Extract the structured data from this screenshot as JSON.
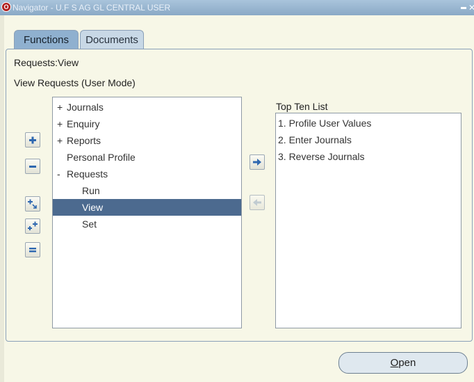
{
  "window": {
    "title": "Navigator - U.F S AG GL CENTRAL USER"
  },
  "tabs": [
    {
      "label": "Functions",
      "active": true
    },
    {
      "label": "Documents",
      "active": false
    }
  ],
  "header": {
    "heading": "Requests:View",
    "subheading": "View Requests (User Mode)"
  },
  "tree": {
    "items": [
      {
        "prefix": "+",
        "label": "Journals"
      },
      {
        "prefix": "+",
        "label": "Enquiry"
      },
      {
        "prefix": "+",
        "label": "Reports"
      },
      {
        "prefix": "",
        "label": "Personal Profile"
      },
      {
        "prefix": "-",
        "label": "Requests"
      },
      {
        "prefix": "",
        "label": "Run",
        "indent": true
      },
      {
        "prefix": "",
        "label": "View",
        "indent": true,
        "selected": true
      },
      {
        "prefix": "",
        "label": "Set",
        "indent": true
      }
    ]
  },
  "top_ten": {
    "title": "Top Ten List",
    "items": [
      "1. Profile User Values",
      "2. Enter Journals",
      "3. Reverse Journals"
    ]
  },
  "buttons": {
    "open_accel": "O",
    "open_rest": "pen"
  },
  "icons": {
    "expand": "expand-icon",
    "collapse": "collapse-icon",
    "expand_all": "expand-all-icon",
    "expand_branch": "expand-branch-icon",
    "collapse_all": "collapse-all-icon",
    "add_to_list": "arrow-right-icon",
    "remove_from_list": "arrow-left-icon"
  },
  "colors": {
    "titlebar": "#8aa9c6",
    "selection": "#4c6a8f",
    "active_tab": "#8fb0cf",
    "background": "#f7f7e7"
  }
}
